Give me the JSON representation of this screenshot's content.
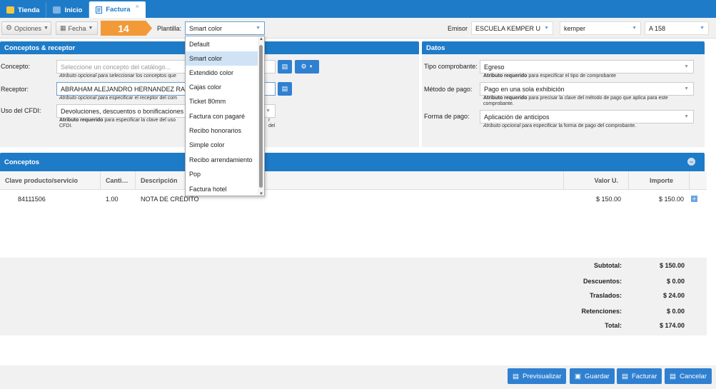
{
  "tabs": [
    {
      "label": "Tienda"
    },
    {
      "label": "Inicio"
    },
    {
      "label": "Factura",
      "close": "×"
    }
  ],
  "toolbar": {
    "opciones": "Opciones",
    "fecha": "Fecha",
    "step": "14",
    "plantilla_label": "Plantilla:",
    "plantilla_value": "Smart color",
    "emisor_label": "Emisor",
    "emisor_value": "ESCUELA KEMPER U",
    "emisor2_value": "kemper",
    "serie_value": "A 158"
  },
  "conceptos_receptor": {
    "title": "Conceptos & receptor",
    "concepto_label": "Concepto:",
    "concepto_placeholder": "Seleccione un concepto del catálogo...",
    "concepto_help_em": "Atributo opcional",
    "concepto_help": " para seleccionar los conceptos que",
    "receptor_label": "Receptor:",
    "receptor_value": "ABRAHAM ALEJANDRO HERNANDEZ RA",
    "receptor_help_em": "Atributo opcional",
    "receptor_help": " para especificar el receptor del com",
    "uso_label": "Uso del CFDI:",
    "uso_value": "Devoluciones, descuentos o bonificaciones",
    "uso_help_strong": "Atributo requerido",
    "uso_help": " para especificar la clave del uso",
    "uso_help_tail": "r del",
    "uso_help_line2": "CFDI."
  },
  "datos": {
    "title": "Datos",
    "tipo_label": "Tipo comprobante:",
    "tipo_value": "Egreso",
    "tipo_help_strong": "Atributo requerido",
    "tipo_help": " para especificar el tipo de comprobante",
    "metodo_label": "Método de pago:",
    "metodo_value": "Pago en una sola exhibición",
    "metodo_help_strong": "Atributo requerido",
    "metodo_help": " para precisar la clave del método de pago que aplica para este",
    "metodo_help_line2": "comprobante.",
    "forma_label": "Forma de pago:",
    "forma_value": "Aplicación de anticipos",
    "forma_help_em": "Atributo opcional",
    "forma_help": " para especificar la forma de pago del comprobante."
  },
  "conceptos": {
    "title": "Conceptos",
    "collapse": "−",
    "headers": {
      "clave": "Clave producto/servicio",
      "cantidad": "Canti…",
      "descripcion": "Descripción",
      "valor": "Valor U.",
      "importe": "Importe"
    },
    "rows": [
      {
        "clave": "84111506",
        "cantidad": "1.00",
        "descripcion": "NOTA DE CRÉDITO",
        "valor": "$ 150.00",
        "importe": "$ 150.00"
      }
    ]
  },
  "totals": {
    "subtotal_label": "Subtotal:",
    "subtotal": "$ 150.00",
    "descuentos_label": "Descuentos:",
    "descuentos": "$ 0.00",
    "traslados_label": "Traslados:",
    "traslados": "$ 24.00",
    "retenciones_label": "Retenciones:",
    "retenciones": "$ 0.00",
    "total_label": "Total:",
    "total": "$ 174.00"
  },
  "footer": {
    "previsualizar": "Previsualizar",
    "guardar": "Guardar",
    "facturar": "Facturar",
    "cancelar": "Cancelar"
  },
  "plantilla_options": [
    "Default",
    "Smart color",
    "Extendido color",
    "Cajas color",
    "Ticket 80mm",
    "Factura con pagaré",
    "Recibo honorarios",
    "Simple color",
    "Recibo arrendamiento",
    "Pop",
    "Factura hotel"
  ],
  "plantilla_selected": "Smart color",
  "colors": {
    "primary": "#1e7bc8",
    "accent": "#f29a38",
    "button": "#2f80d1"
  }
}
